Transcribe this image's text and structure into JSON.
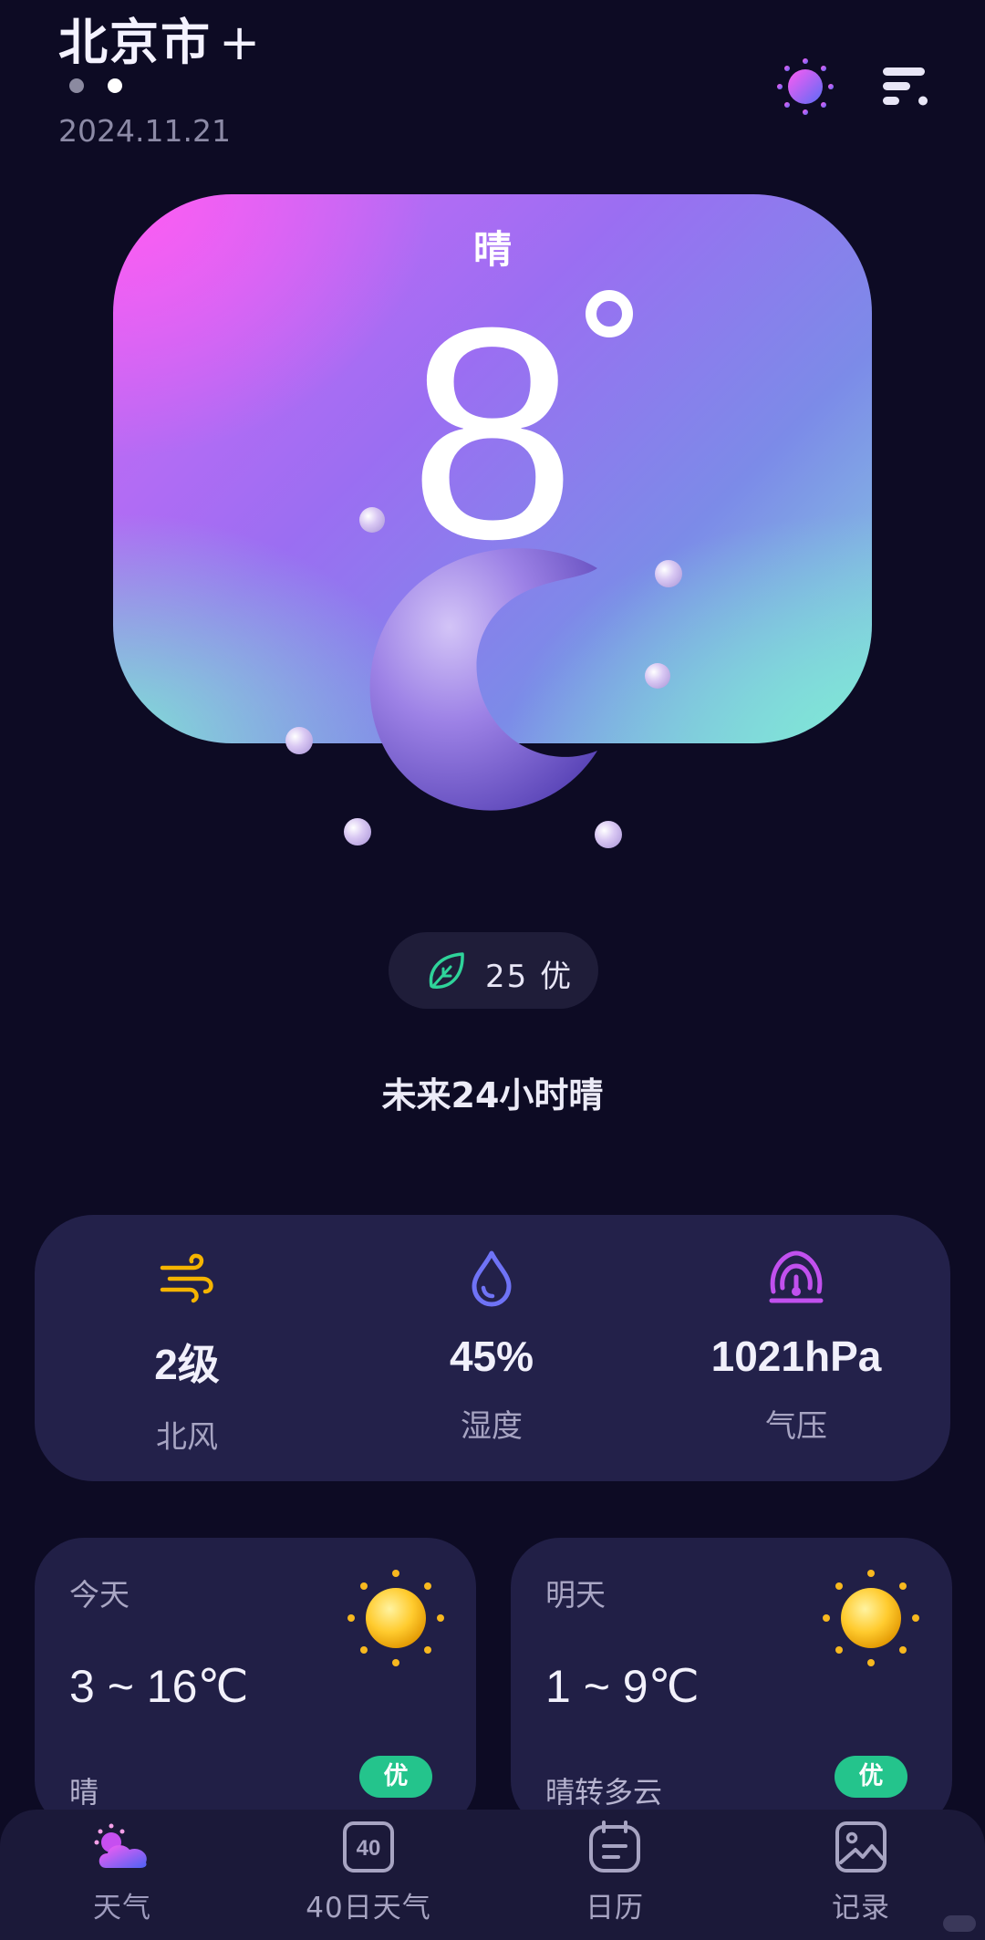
{
  "header": {
    "city": "北京市",
    "add_label": "+",
    "date": "2024.11.21"
  },
  "hero": {
    "condition": "晴",
    "temperature": "8",
    "degree_symbol": "°"
  },
  "aqi": {
    "value": "25",
    "level": "优",
    "icon": "leaf-icon"
  },
  "forecast_text": "未来24小时晴",
  "stats": [
    {
      "icon": "wind-icon",
      "value": "2级",
      "label": "北风",
      "color": "#f5b400"
    },
    {
      "icon": "humidity-drop-icon",
      "value": "45%",
      "label": "湿度",
      "color": "#6f73f6"
    },
    {
      "icon": "pressure-gauge-icon",
      "value": "1021hPa",
      "label": "气压",
      "color": "#c150ee"
    }
  ],
  "days": [
    {
      "title": "今天",
      "temp": "3 ~ 16℃",
      "condition": "晴",
      "badge": "优",
      "icon": "sun-icon"
    },
    {
      "title": "明天",
      "temp": "1 ~ 9℃",
      "condition": "晴转多云",
      "badge": "优",
      "icon": "sun-icon"
    }
  ],
  "nav": [
    {
      "label": "天气",
      "icon": "weather-cloud-icon",
      "active": true
    },
    {
      "label": "40日天气",
      "icon": "calendar-40-icon",
      "active": false
    },
    {
      "label": "日历",
      "icon": "calendar-icon",
      "active": false
    },
    {
      "label": "记录",
      "icon": "gallery-icon",
      "active": false
    }
  ],
  "colors": {
    "background": "#0d0b24",
    "card": "#23214a",
    "badge_green": "#24c48c",
    "wind_yellow": "#f5b400"
  }
}
